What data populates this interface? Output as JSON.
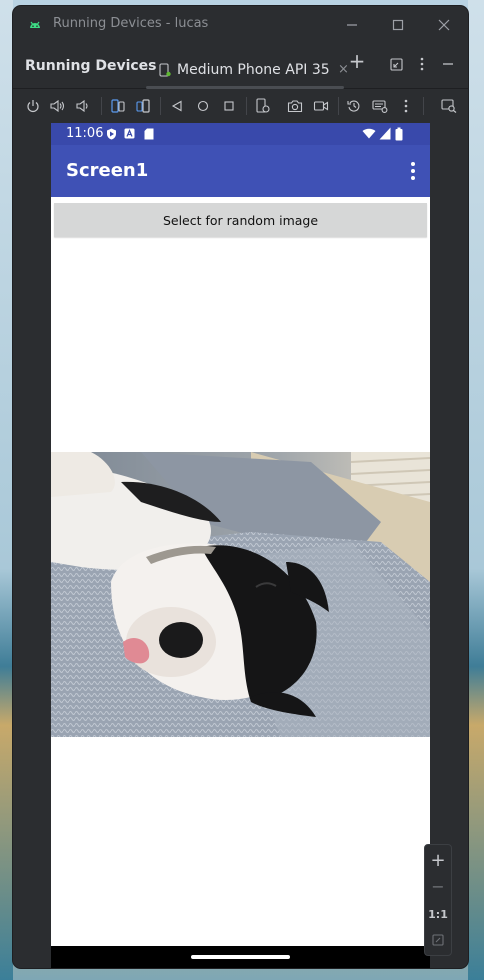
{
  "window": {
    "title": "Running Devices - lucas"
  },
  "panel": {
    "title": "Running Devices"
  },
  "device_tab": {
    "label": "Medium Phone API 35",
    "close": "×"
  },
  "tab_actions": {
    "add": "+"
  },
  "phone": {
    "status_time": "11:06",
    "app_title": "Screen1",
    "button_label": "Select for random image"
  },
  "zoom": {
    "in": "+",
    "out": "−",
    "reset": "1:1"
  },
  "colors": {
    "app_bar": "#3f51b5",
    "status_bar": "#3949ab",
    "ide_bg": "#2b2d30"
  }
}
